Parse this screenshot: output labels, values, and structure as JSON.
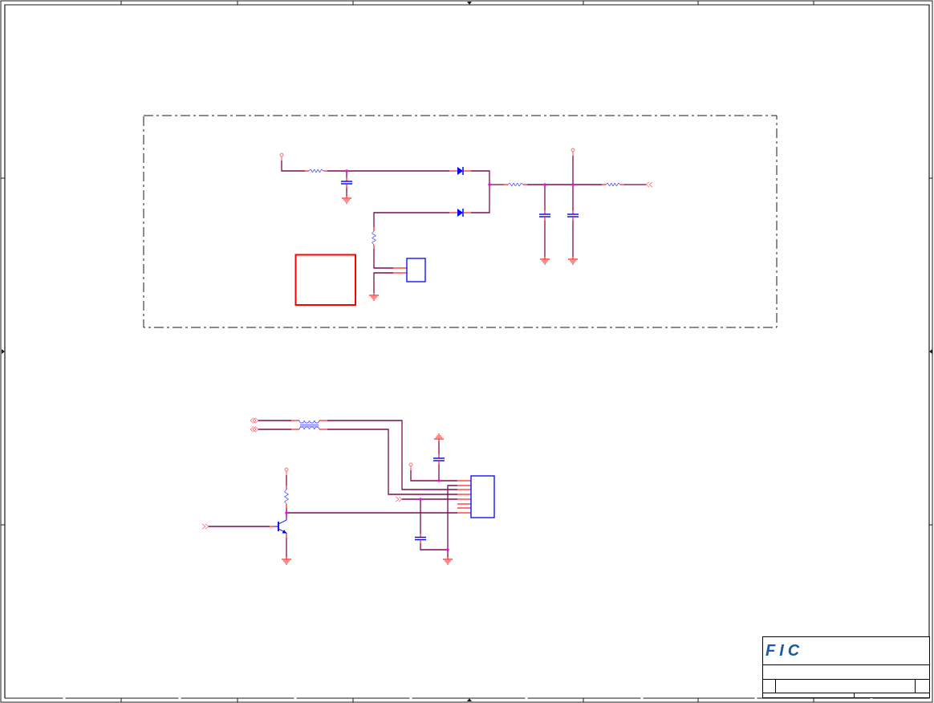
{
  "title_block": {
    "logo": "FIC"
  }
}
